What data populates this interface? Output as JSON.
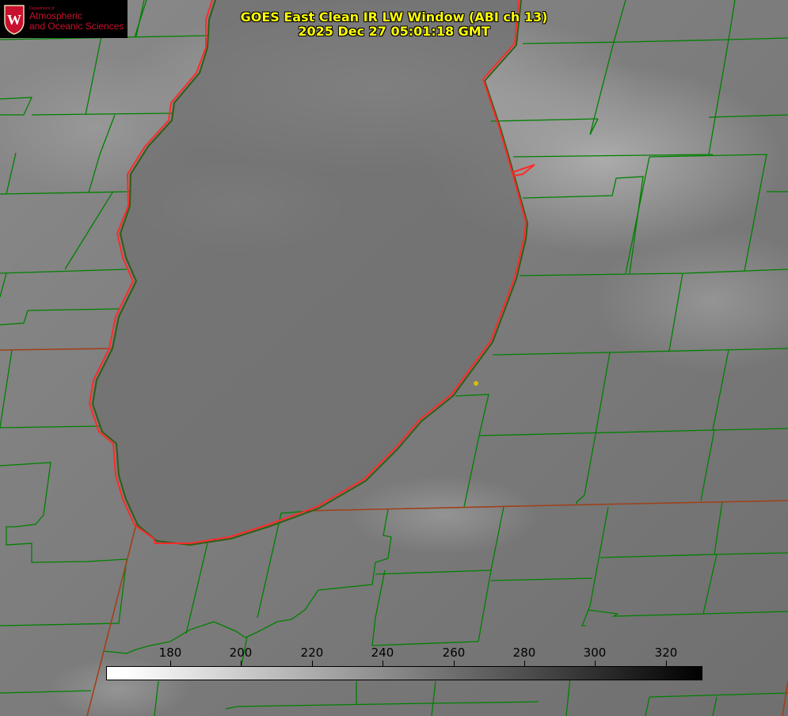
{
  "header": {
    "title_line1": "GOES East Clean IR LW Window (ABI ch 13)",
    "title_line2": "2025 Dec 27 05:01:18 GMT"
  },
  "logo": {
    "department": "Department of",
    "line1": "Atmospheric",
    "line2": "and Oceanic Sciences",
    "seal_letter": "W"
  },
  "colorbar": {
    "ticks": [
      "180",
      "200",
      "220",
      "240",
      "260",
      "280",
      "300",
      "320"
    ]
  },
  "colors": {
    "title": "#ffff00",
    "county_lines": "#008000",
    "state_lines": "#b03a10",
    "coastline": "#ff0000",
    "marker": "#d4c000",
    "logo_red": "#c8102e"
  }
}
